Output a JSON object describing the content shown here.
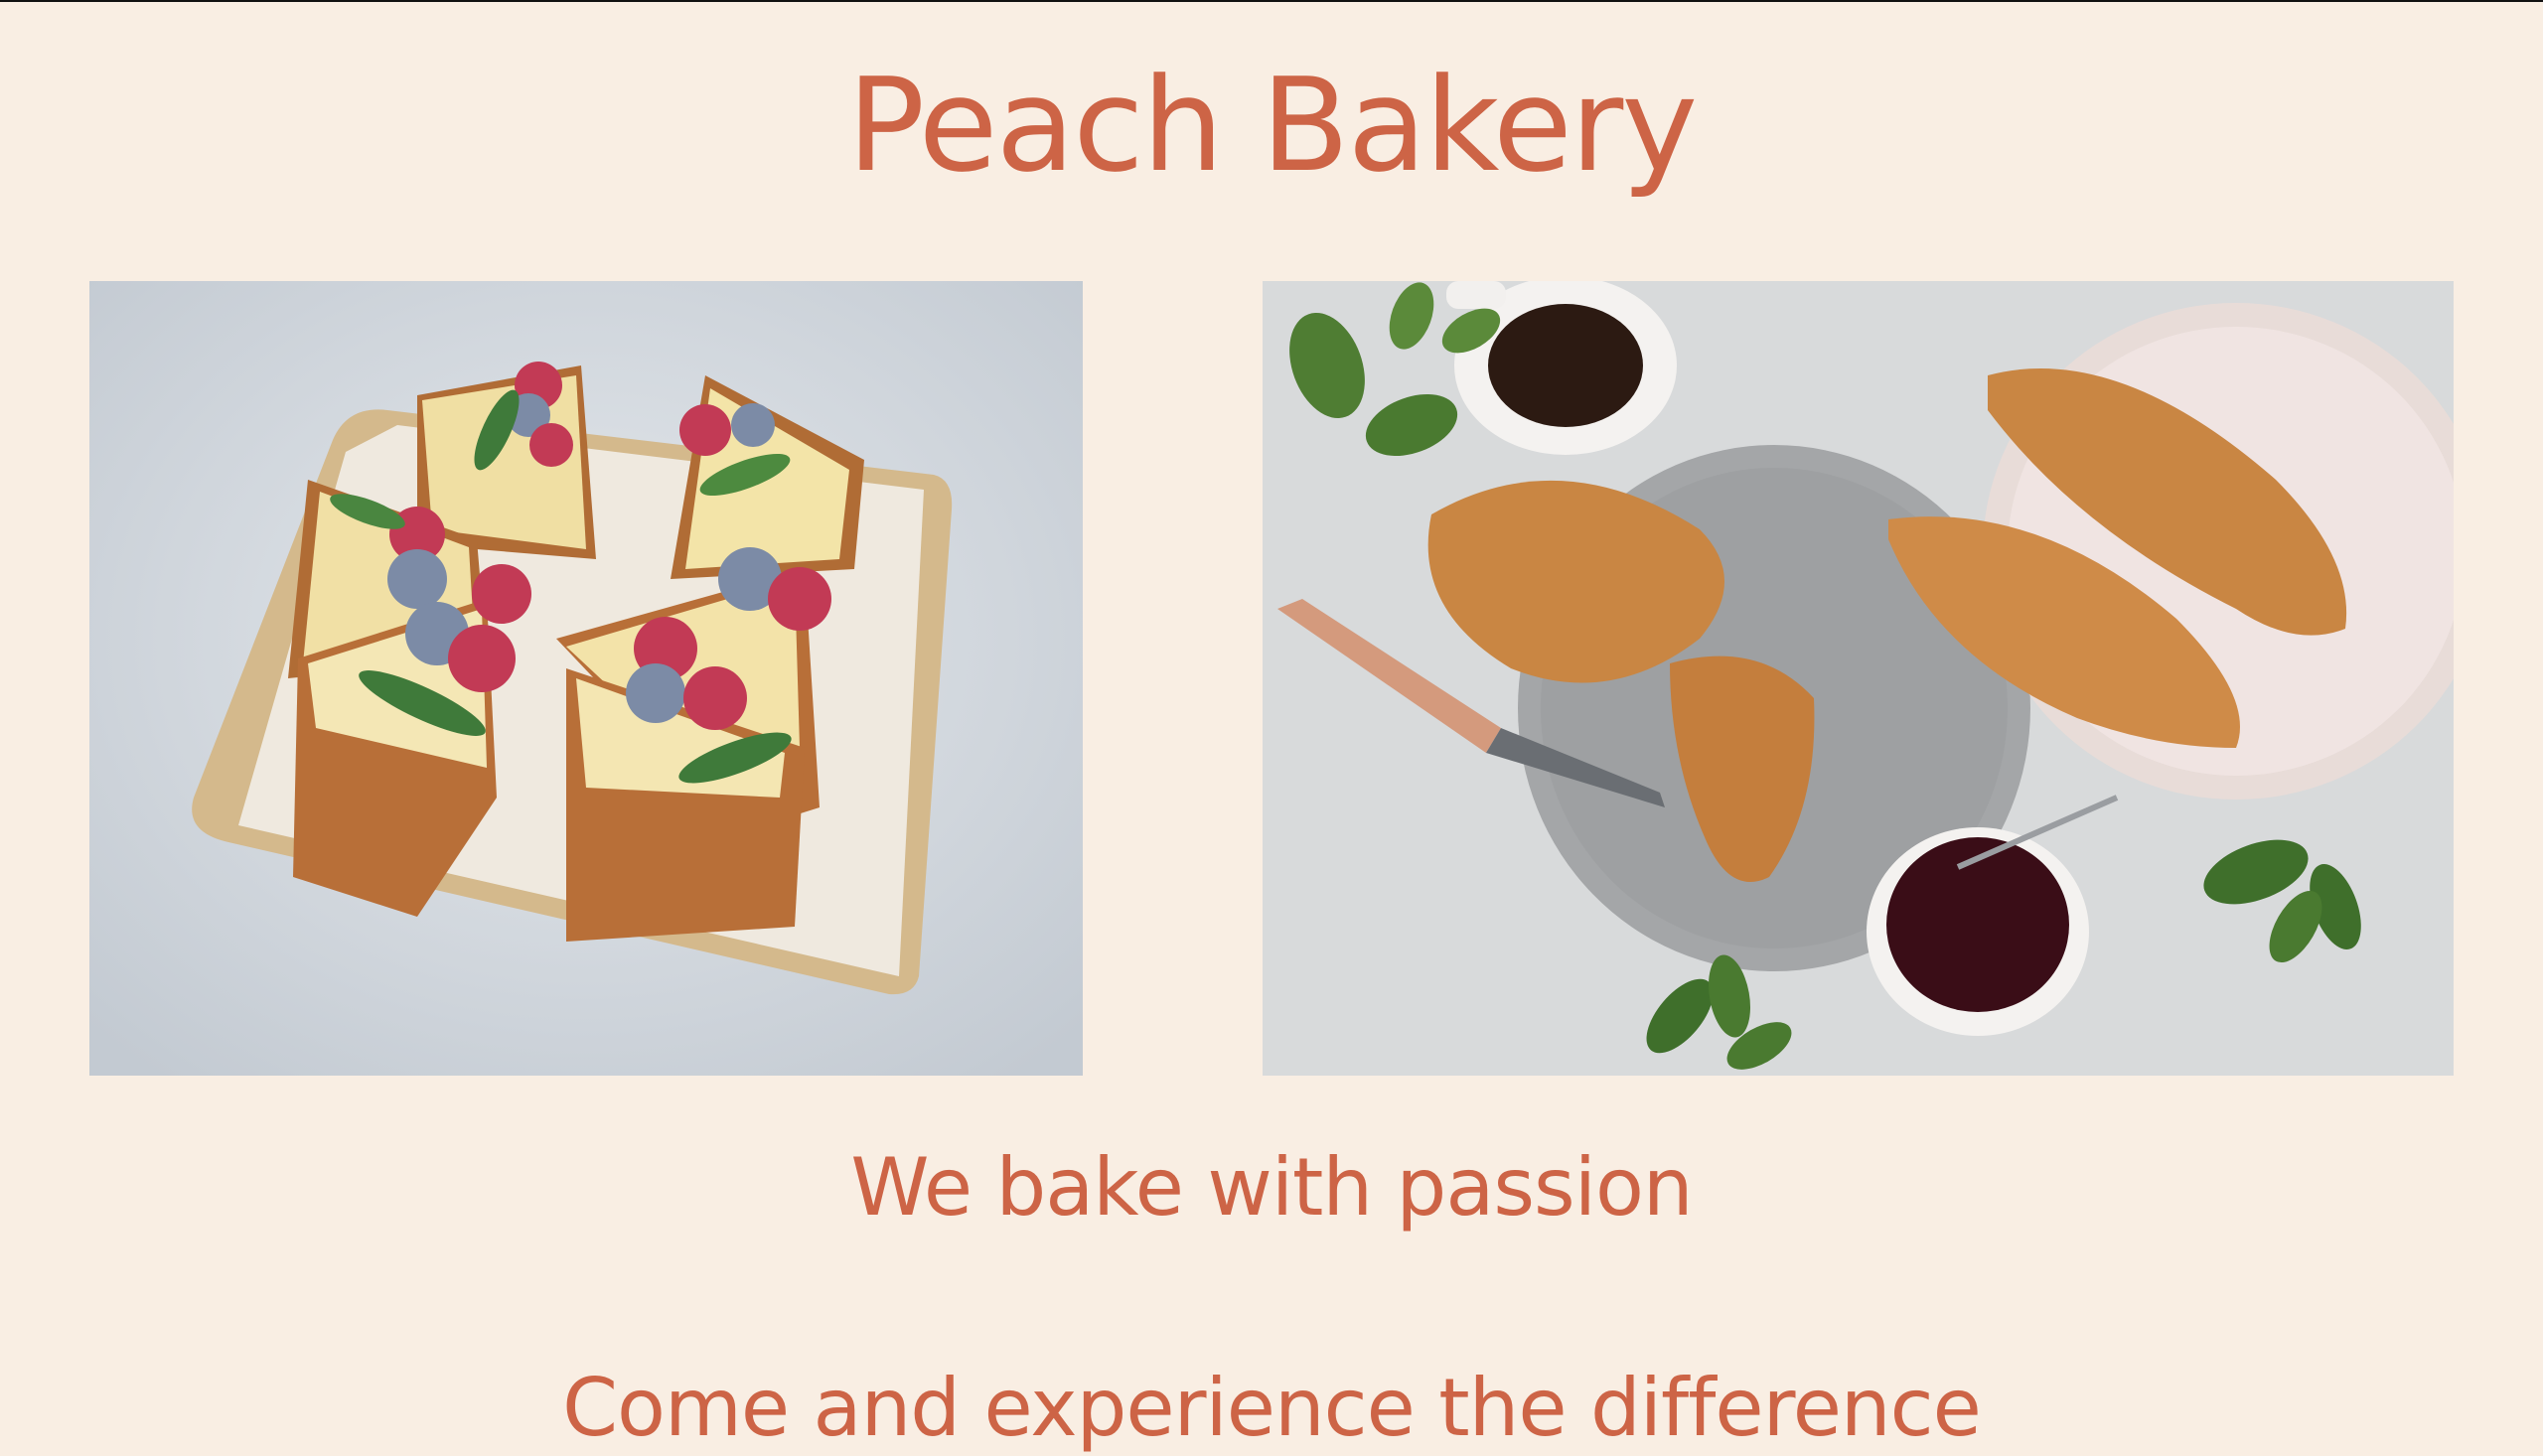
{
  "header": {
    "title": "Peach Bakery"
  },
  "hero": {
    "tagline": "We bake with passion",
    "subtagline": "Come and experience the difference"
  },
  "gallery": [
    {
      "icon": "cheesecake-photo"
    },
    {
      "icon": "croissants-photo"
    }
  ],
  "colors": {
    "background": "#f9eee3",
    "accent": "#cd6446"
  }
}
